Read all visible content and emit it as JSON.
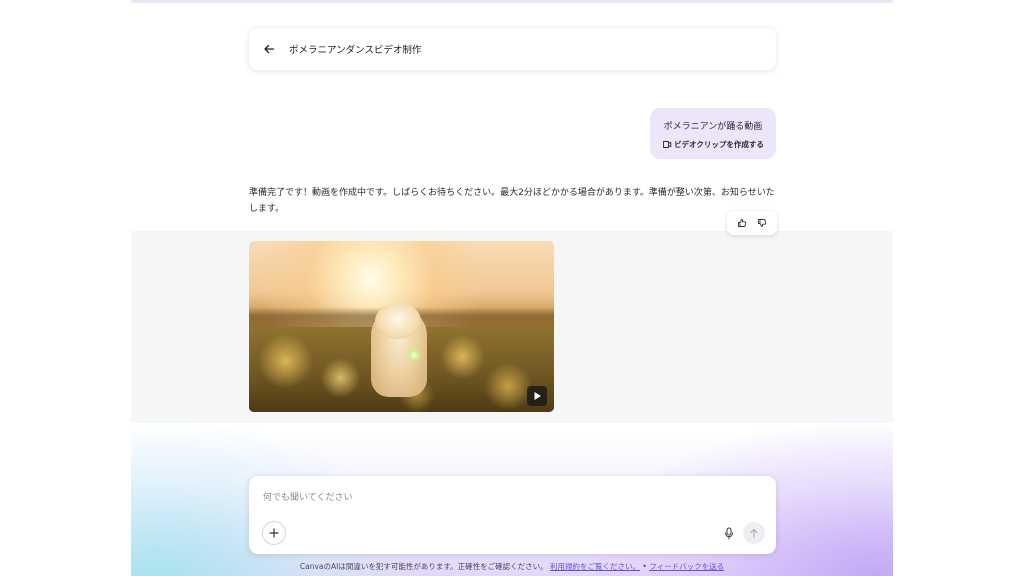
{
  "header": {
    "back_icon": "arrow-left-icon",
    "title": "ポメラニアンダンスビデオ制作"
  },
  "conversation": {
    "user_message": {
      "text": "ポメラニアンが踊る動画",
      "chip_icon": "video-clip-icon",
      "chip_label": "ビデオクリップを作成する"
    },
    "assistant_message": {
      "text": "準備完了です！動画を作成中です。しばらくお待ちください。最大2分ほどかかる場合があります。準備が整い次第、お知らせいたします。"
    },
    "feedback": {
      "thumbs_up_icon": "thumbs-up-icon",
      "thumbs_down_icon": "thumbs-down-icon"
    },
    "video": {
      "play_icon": "play-icon"
    }
  },
  "composer": {
    "placeholder": "何でも聞いてください",
    "add_icon": "plus-icon",
    "mic_icon": "microphone-icon",
    "send_icon": "arrow-up-icon"
  },
  "footer": {
    "disclaimer": "CanvaのAIは間違いを犯す可能性があります。正確性をご確認ください。",
    "terms_link": "利用規約をご覧ください。",
    "separator": "•",
    "feedback_link": "フィードバックを送る"
  },
  "colors": {
    "user_bubble": "#ede6fb",
    "link": "#6b4fd8",
    "band": "#f5f6f8"
  }
}
